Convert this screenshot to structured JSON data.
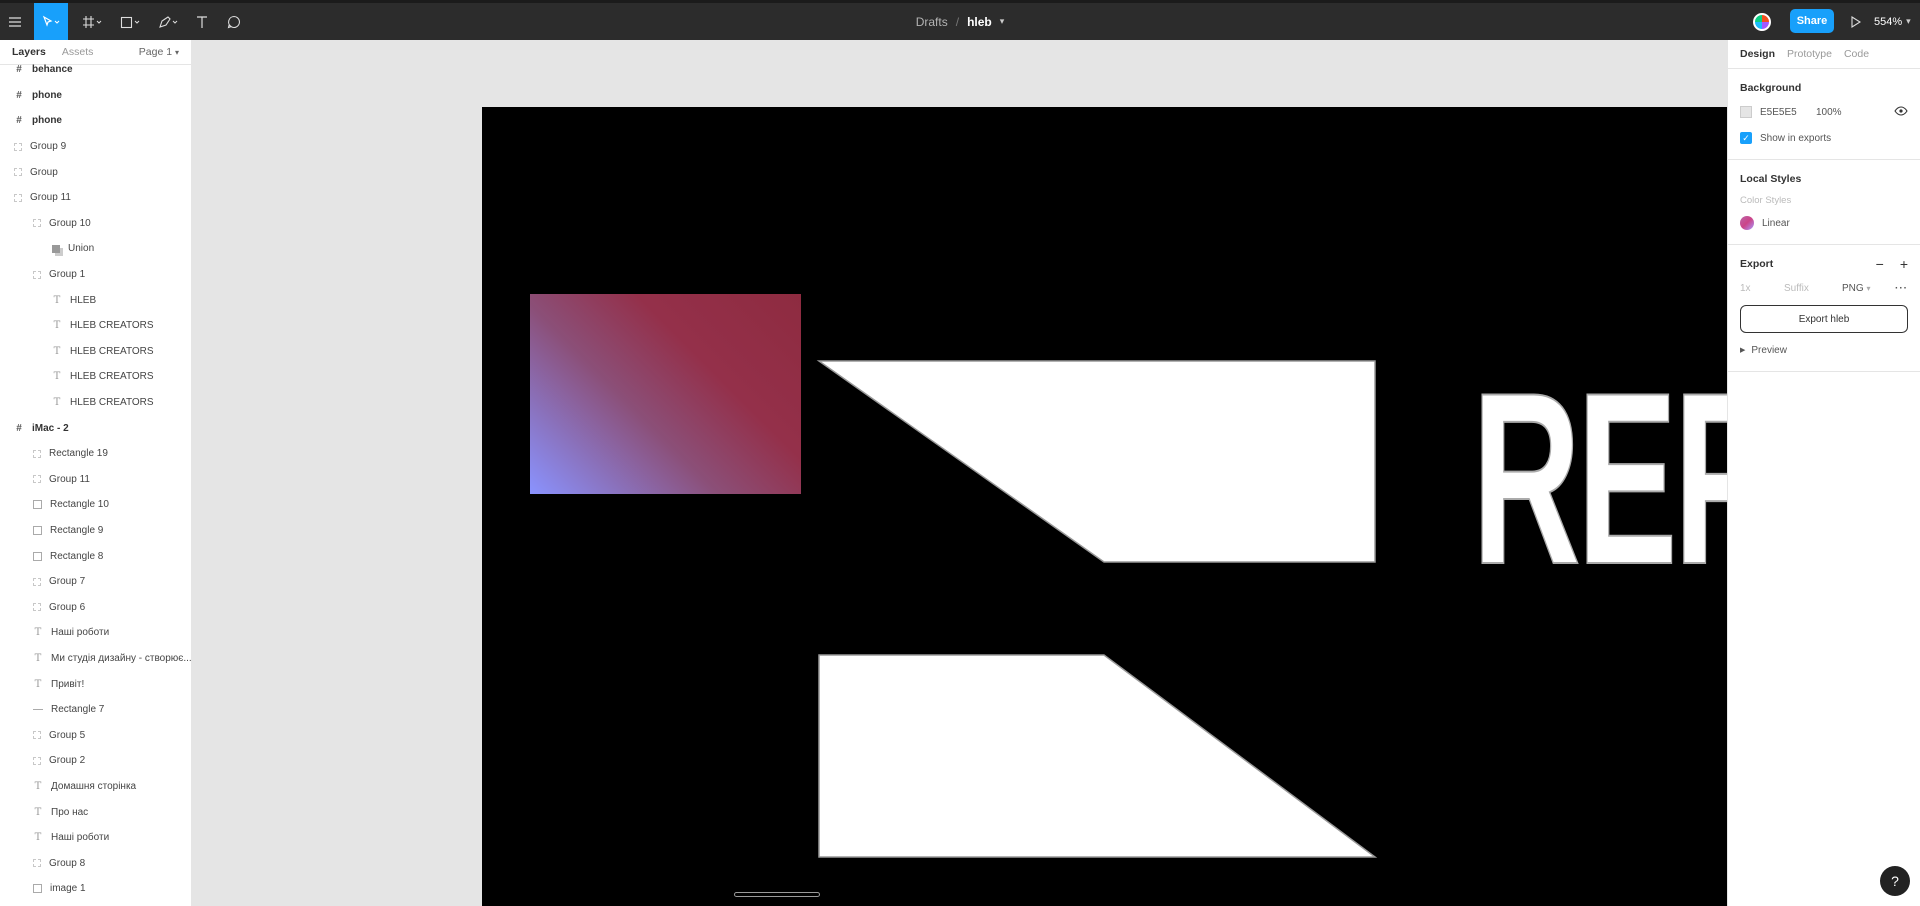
{
  "toolbar": {
    "breadcrumb_drafts": "Drafts",
    "breadcrumb_sep": "/",
    "file_name": "hleb",
    "share_label": "Share",
    "zoom": "554%",
    "icons": [
      "menu-icon",
      "move-tool-icon",
      "frame-tool-icon",
      "shape-tool-icon",
      "pen-tool-icon",
      "text-tool-icon",
      "comment-tool-icon",
      "play-icon"
    ]
  },
  "left_panel": {
    "tab_layers": "Layers",
    "tab_assets": "Assets",
    "page": "Page 1",
    "layers": [
      {
        "label": "behance",
        "type": "frame",
        "indent": 0,
        "bold": true
      },
      {
        "label": "phone",
        "type": "frame",
        "indent": 0,
        "bold": true
      },
      {
        "label": "phone",
        "type": "frame",
        "indent": 0,
        "bold": true
      },
      {
        "label": "Group 9",
        "type": "group",
        "indent": 0
      },
      {
        "label": "Group",
        "type": "group",
        "indent": 0
      },
      {
        "label": "Group 11",
        "type": "group",
        "indent": 0
      },
      {
        "label": "Group 10",
        "type": "group",
        "indent": 1
      },
      {
        "label": "Union",
        "type": "union",
        "indent": 2
      },
      {
        "label": "Group 1",
        "type": "group",
        "indent": 1
      },
      {
        "label": "HLEB",
        "type": "text",
        "indent": 2
      },
      {
        "label": "HLEB CREATORS",
        "type": "text",
        "indent": 2
      },
      {
        "label": "HLEB CREATORS",
        "type": "text",
        "indent": 2
      },
      {
        "label": "HLEB CREATORS",
        "type": "text",
        "indent": 2
      },
      {
        "label": "HLEB CREATORS",
        "type": "text",
        "indent": 2
      },
      {
        "label": "iMac - 2",
        "type": "frame",
        "indent": 0,
        "bold": true
      },
      {
        "label": "Rectangle 19",
        "type": "group",
        "indent": 1
      },
      {
        "label": "Group 11",
        "type": "group",
        "indent": 1
      },
      {
        "label": "Rectangle 10",
        "type": "image",
        "indent": 1
      },
      {
        "label": "Rectangle 9",
        "type": "image",
        "indent": 1
      },
      {
        "label": "Rectangle 8",
        "type": "image",
        "indent": 1
      },
      {
        "label": "Group 7",
        "type": "group",
        "indent": 1
      },
      {
        "label": "Group 6",
        "type": "group",
        "indent": 1
      },
      {
        "label": "Наші роботи",
        "type": "text",
        "indent": 1
      },
      {
        "label": "Ми студія дизайну - створює...",
        "type": "text",
        "indent": 1
      },
      {
        "label": "Привіт!",
        "type": "text",
        "indent": 1
      },
      {
        "label": "Rectangle 7",
        "type": "rule",
        "indent": 1
      },
      {
        "label": "Group 5",
        "type": "group",
        "indent": 1
      },
      {
        "label": "Group 2",
        "type": "group",
        "indent": 1
      },
      {
        "label": "Домашня сторінка",
        "type": "text",
        "indent": 1
      },
      {
        "label": "Про нас",
        "type": "text",
        "indent": 1
      },
      {
        "label": "Наші роботи",
        "type": "text",
        "indent": 1
      },
      {
        "label": "Group 8",
        "type": "group",
        "indent": 1
      },
      {
        "label": "image 1",
        "type": "image",
        "indent": 1
      }
    ]
  },
  "canvas": {
    "headline_partial": "REF"
  },
  "right_panel": {
    "tab_design": "Design",
    "tab_prototype": "Prototype",
    "tab_code": "Code",
    "background_title": "Background",
    "background_hex": "E5E5E5",
    "background_opacity": "100%",
    "show_in_exports": "Show in exports",
    "local_styles_title": "Local Styles",
    "color_styles": "Color Styles",
    "style_linear": "Linear",
    "export_title": "Export",
    "export_scale": "1x",
    "export_suffix_placeholder": "Suffix",
    "export_format": "PNG",
    "export_button": "Export hleb",
    "preview": "Preview",
    "help": "?"
  }
}
